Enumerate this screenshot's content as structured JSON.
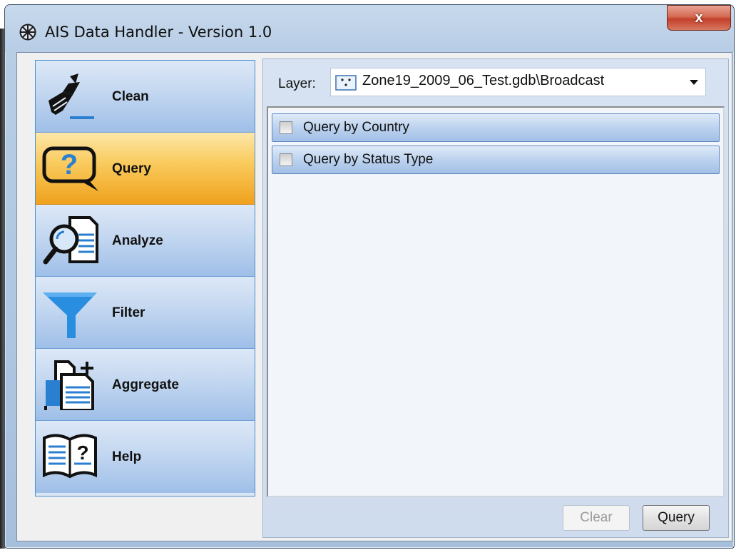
{
  "window": {
    "title": "AIS Data Handler - Version 1.0",
    "close_label": "x"
  },
  "sidebar": {
    "items": [
      {
        "label": "Clean",
        "icon": "broom-icon",
        "active": false
      },
      {
        "label": "Query",
        "icon": "question-bubble-icon",
        "active": true
      },
      {
        "label": "Analyze",
        "icon": "magnify-document-icon",
        "active": false
      },
      {
        "label": "Filter",
        "icon": "funnel-icon",
        "active": false
      },
      {
        "label": "Aggregate",
        "icon": "add-documents-icon",
        "active": false
      },
      {
        "label": "Help",
        "icon": "help-book-icon",
        "active": false
      }
    ]
  },
  "main": {
    "layer_label": "Layer:",
    "layer_value": "Zone19_2009_06_Test.gdb\\Broadcast",
    "queries": [
      {
        "label": "Query by Country",
        "checked": false
      },
      {
        "label": "Query by Status Type",
        "checked": false
      }
    ],
    "clear_button": "Clear",
    "query_button": "Query"
  },
  "colors": {
    "active_nav": "#f5b630",
    "nav": "#b6cdee",
    "close_button": "#c3402b"
  }
}
